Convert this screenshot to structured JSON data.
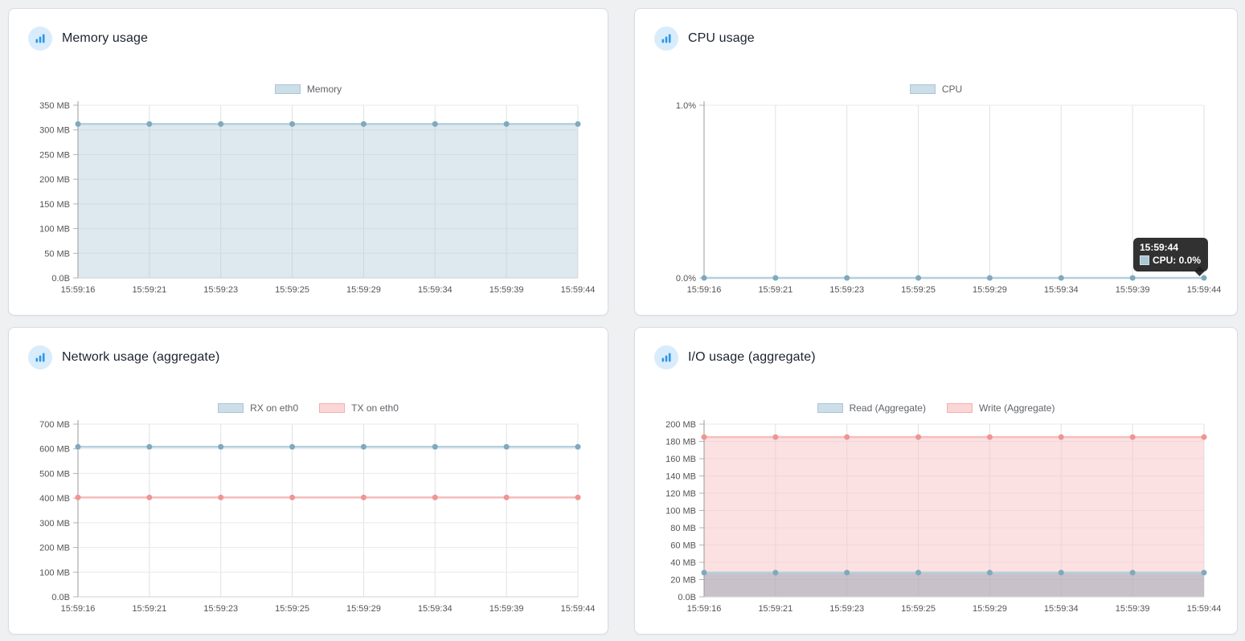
{
  "page": {
    "background": "#eff0f2"
  },
  "colors": {
    "blue": {
      "stroke": "#b5cfdb",
      "point": "#7fa9bd",
      "fill": "rgba(170,200,214,0.40)",
      "legend_bg": "#ccdee8",
      "legend_border": "#a9c6d4"
    },
    "pink": {
      "stroke": "#f6bdbd",
      "point": "#f09494",
      "fill": "rgba(247,196,196,0.50)",
      "legend_bg": "#fbd6d6",
      "legend_border": "#f2b0b0"
    }
  },
  "tooltip": {
    "time": "15:59:44",
    "text": "CPU: 0.0%"
  },
  "icons": {
    "panel_icon": "bar-chart"
  },
  "chart_data": [
    {
      "type": "area",
      "title": "Memory usage",
      "xlabel": "",
      "ylabel": "",
      "grid": true,
      "legend_position": "top-center",
      "x": [
        "15:59:16",
        "15:59:21",
        "15:59:23",
        "15:59:25",
        "15:59:29",
        "15:59:34",
        "15:59:39",
        "15:59:44"
      ],
      "ylim": [
        0,
        350
      ],
      "ytick_labels": [
        "350 MB",
        "300 MB",
        "250 MB",
        "200 MB",
        "150 MB",
        "100 MB",
        "50 MB",
        "0.0B"
      ],
      "series": [
        {
          "name": "Memory",
          "color_key": "blue",
          "fill": true,
          "values": [
            312,
            312,
            312,
            312,
            312,
            312,
            312,
            312
          ]
        }
      ]
    },
    {
      "type": "line",
      "title": "CPU usage",
      "xlabel": "",
      "ylabel": "",
      "grid": true,
      "legend_position": "top-center",
      "x": [
        "15:59:16",
        "15:59:21",
        "15:59:23",
        "15:59:25",
        "15:59:29",
        "15:59:34",
        "15:59:39",
        "15:59:44"
      ],
      "ylim": [
        0,
        1
      ],
      "ytick_labels": [
        "1.0%",
        "0.0%"
      ],
      "series": [
        {
          "name": "CPU",
          "color_key": "blue",
          "fill": false,
          "values": [
            0,
            0,
            0,
            0,
            0,
            0,
            0,
            0
          ]
        }
      ],
      "tooltip": {
        "time": "15:59:44",
        "text": "CPU: 0.0%"
      }
    },
    {
      "type": "line",
      "title": "Network usage (aggregate)",
      "xlabel": "",
      "ylabel": "",
      "grid": true,
      "legend_position": "top-center",
      "x": [
        "15:59:16",
        "15:59:21",
        "15:59:23",
        "15:59:25",
        "15:59:29",
        "15:59:34",
        "15:59:39",
        "15:59:44"
      ],
      "ylim": [
        0,
        700
      ],
      "ytick_labels": [
        "700 MB",
        "600 MB",
        "500 MB",
        "400 MB",
        "300 MB",
        "200 MB",
        "100 MB",
        "0.0B"
      ],
      "series": [
        {
          "name": "RX on eth0",
          "color_key": "blue",
          "fill": false,
          "values": [
            608,
            608,
            608,
            608,
            608,
            608,
            608,
            608
          ]
        },
        {
          "name": "TX on eth0",
          "color_key": "pink",
          "fill": false,
          "values": [
            403,
            403,
            403,
            403,
            403,
            403,
            403,
            403
          ]
        }
      ]
    },
    {
      "type": "area",
      "title": "I/O usage (aggregate)",
      "xlabel": "",
      "ylabel": "",
      "grid": true,
      "legend_position": "top-center",
      "x": [
        "15:59:16",
        "15:59:21",
        "15:59:23",
        "15:59:25",
        "15:59:29",
        "15:59:34",
        "15:59:39",
        "15:59:44"
      ],
      "ylim": [
        0,
        200
      ],
      "ytick_labels": [
        "200 MB",
        "180 MB",
        "160 MB",
        "140 MB",
        "120 MB",
        "100 MB",
        "80 MB",
        "60 MB",
        "40 MB",
        "20 MB",
        "0.0B"
      ],
      "series": [
        {
          "name": "Read (Aggregate)",
          "color_key": "blue",
          "fill": true,
          "fill_color": "rgba(138,155,172,0.45)",
          "values": [
            28,
            28,
            28,
            28,
            28,
            28,
            28,
            28
          ]
        },
        {
          "name": "Write (Aggregate)",
          "color_key": "pink",
          "fill": true,
          "values": [
            185,
            185,
            185,
            185,
            185,
            185,
            185,
            185
          ]
        }
      ]
    }
  ]
}
